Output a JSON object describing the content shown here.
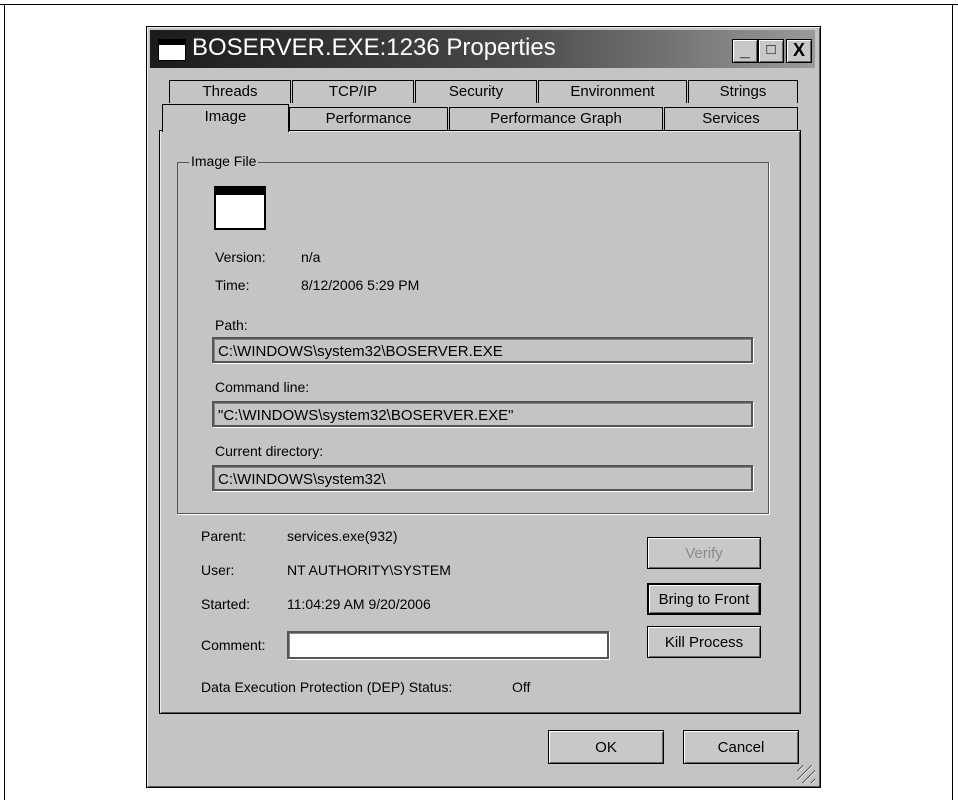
{
  "window": {
    "title": "BOSERVER.EXE:1236 Properties"
  },
  "titlebar_buttons": {
    "minimize": "_",
    "maximize": "□",
    "close": "X"
  },
  "tabs_row1": [
    "Threads",
    "TCP/IP",
    "Security",
    "Environment",
    "Strings"
  ],
  "tabs_row2": [
    "Image",
    "Performance",
    "Performance Graph",
    "Services"
  ],
  "active_tab": "Image",
  "image_file": {
    "group_label": "Image File",
    "version_label": "Version:",
    "version_value": "n/a",
    "time_label": "Time:",
    "time_value": "8/12/2006 5:29 PM",
    "path_label": "Path:",
    "path_value": "C:\\WINDOWS\\system32\\BOSERVER.EXE",
    "cmdline_label": "Command line:",
    "cmdline_value": "\"C:\\WINDOWS\\system32\\BOSERVER.EXE\"",
    "curdir_label": "Current directory:",
    "curdir_value": "C:\\WINDOWS\\system32\\"
  },
  "process": {
    "parent_label": "Parent:",
    "parent_value": "services.exe(932)",
    "user_label": "User:",
    "user_value": "NT AUTHORITY\\SYSTEM",
    "started_label": "Started:",
    "started_value": "11:04:29 AM  9/20/2006",
    "comment_label": "Comment:",
    "comment_value": "",
    "dep_label": "Data Execution Protection (DEP) Status:",
    "dep_value": "Off"
  },
  "buttons": {
    "verify": "Verify",
    "bring_to_front": "Bring to Front",
    "kill_process": "Kill Process",
    "ok": "OK",
    "cancel": "Cancel"
  },
  "icons": {
    "window_icon": "application-window-icon",
    "image_icon": "application-window-icon",
    "grip": "resize-grip-icon"
  }
}
